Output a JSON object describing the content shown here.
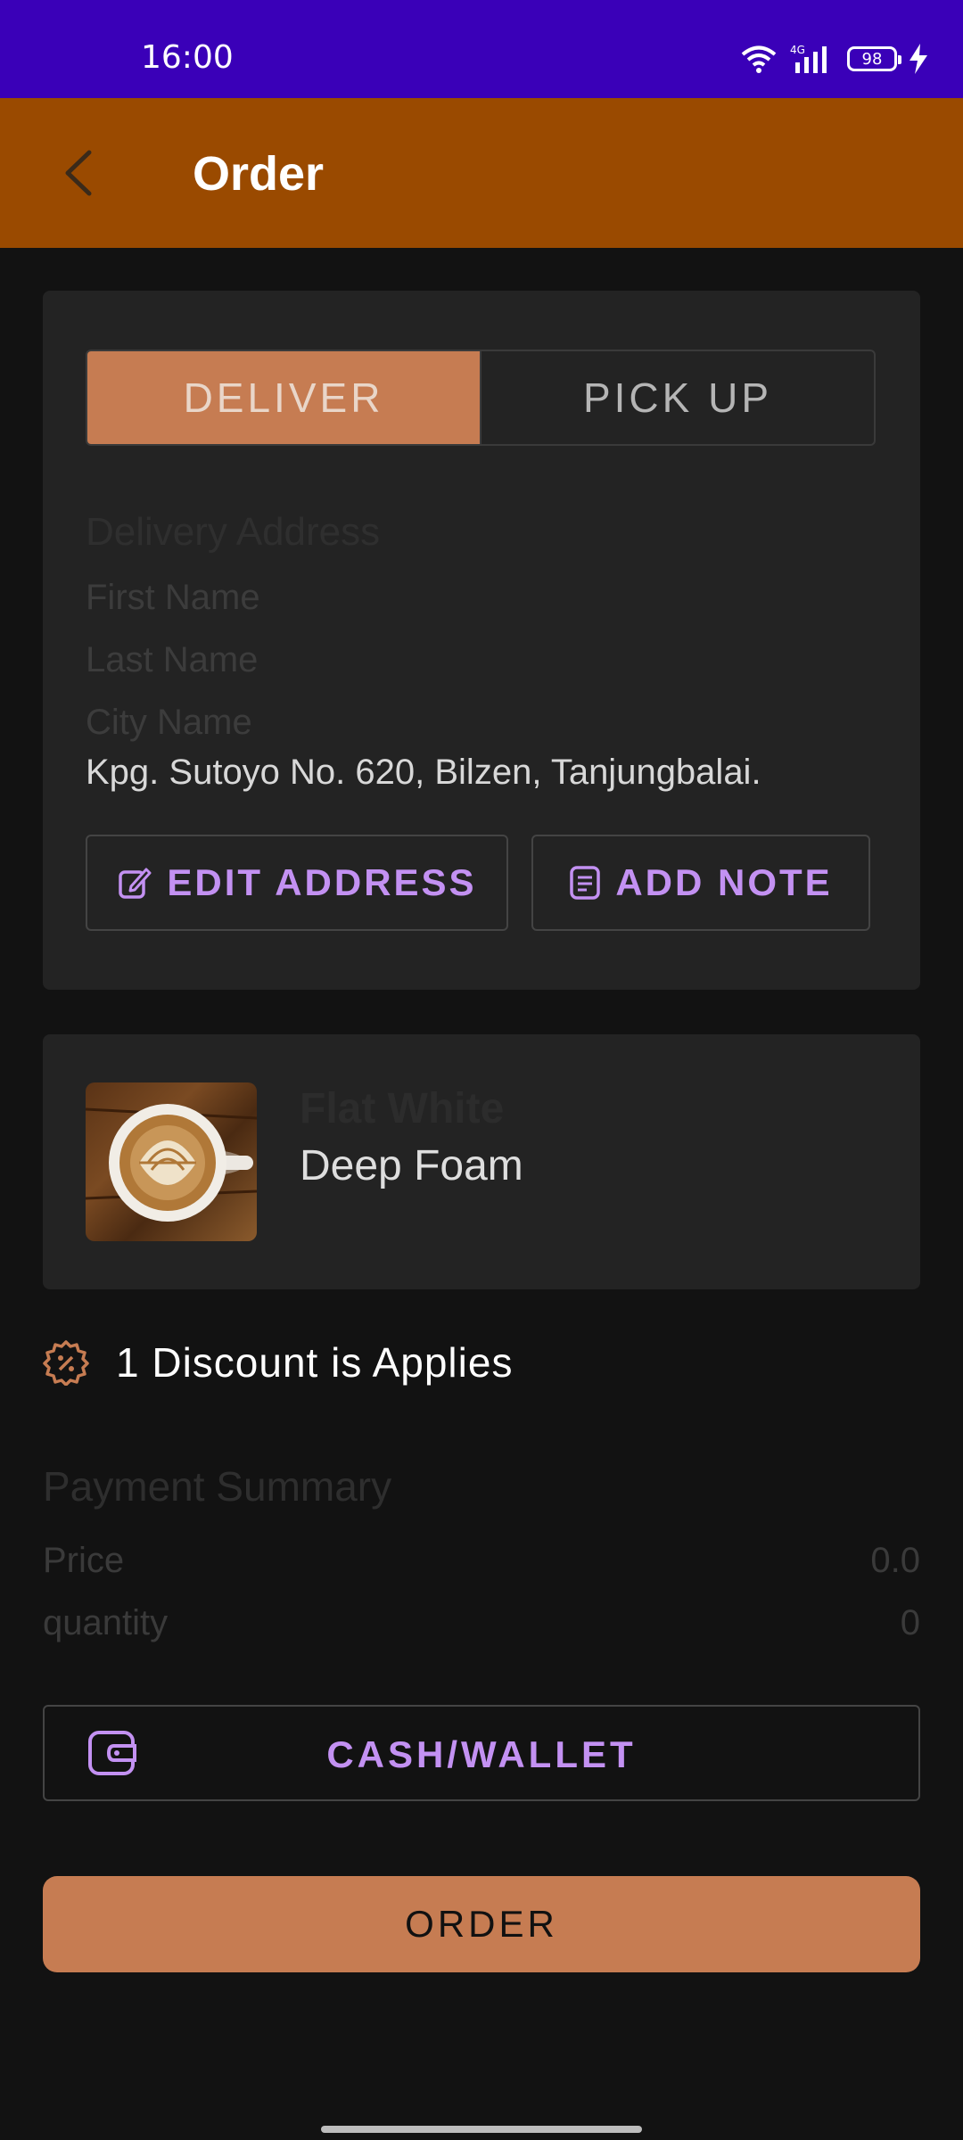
{
  "status_bar": {
    "time": "16:00",
    "network": "4G",
    "battery": "98"
  },
  "app_bar": {
    "title": "Order"
  },
  "delivery_toggle": {
    "deliver_label": "DELIVER",
    "pickup_label": "PICK UP",
    "selected": "DELIVER"
  },
  "address": {
    "heading": "Delivery Address",
    "first_name": "First Name",
    "last_name": "Last Name",
    "city_name": "City Name",
    "full_address": "Kpg. Sutoyo No. 620, Bilzen, Tanjungbalai.",
    "edit_label": "EDIT ADDRESS",
    "note_label": "ADD NOTE"
  },
  "product": {
    "name": "Flat White",
    "variant": "Deep Foam"
  },
  "discount": {
    "text": "1 Discount is Applies"
  },
  "payment_summary": {
    "title": "Payment Summary",
    "price_label": "Price",
    "price_value": "0.0",
    "quantity_label": "quantity",
    "quantity_value": "0"
  },
  "payment_method": {
    "label": "CASH/WALLET"
  },
  "order_button": {
    "label": "ORDER"
  },
  "colors": {
    "status_bar": "#3a00b8",
    "app_bar": "#9a4a00",
    "accent": "#c67c52",
    "button_text_accent": "#c391f2",
    "background": "#121212",
    "card": "#232323"
  }
}
